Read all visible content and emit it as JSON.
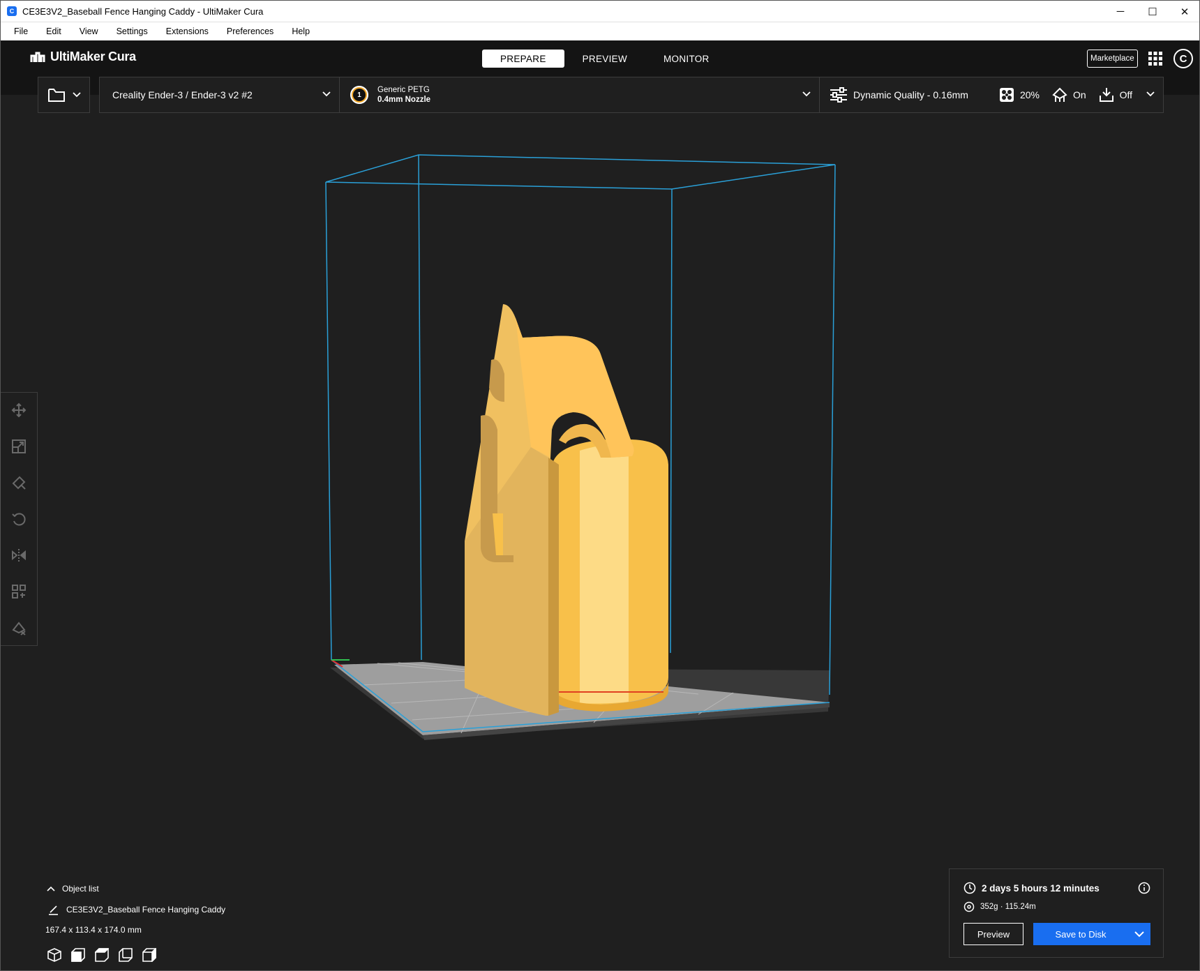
{
  "window": {
    "title": "CE3E3V2_Baseball Fence Hanging Caddy - UltiMaker Cura",
    "minimize": "─",
    "maximize": "☐",
    "close": "✕"
  },
  "menu": [
    "File",
    "Edit",
    "View",
    "Settings",
    "Extensions",
    "Preferences",
    "Help"
  ],
  "header": {
    "logo_text": "UltiMaker Cura",
    "stages": [
      "PREPARE",
      "PREVIEW",
      "MONITOR"
    ],
    "active_stage": "PREPARE",
    "marketplace_label": "Marketplace",
    "account_initial": "C"
  },
  "toolbar": {
    "printer": "Creality Ender-3 / Ender-3 v2 #2",
    "extruder_number": "1",
    "material": "Generic PETG",
    "nozzle": "0.4mm Nozzle",
    "profile": "Dynamic Quality - 0.16mm",
    "infill": "20%",
    "support": "On",
    "adhesion": "Off"
  },
  "left_tools": [
    "move-tool",
    "scale-tool",
    "support-blocker-tool",
    "rotate-tool",
    "mirror-tool",
    "per-model-settings-tool",
    "support-eraser-tool"
  ],
  "object_list": {
    "header": "Object list",
    "object_name": "CE3E3V2_Baseball Fence Hanging Caddy",
    "dimensions": "167.4 x 113.4 x 174.0 mm"
  },
  "action_panel": {
    "print_time": "2 days 5 hours 12 minutes",
    "material_usage": "352g · 115.24m",
    "preview_label": "Preview",
    "save_label": "Save to Disk"
  },
  "colors": {
    "accent": "#196ef0",
    "model": "#f8c04a",
    "build_volume": "#2aa0d8",
    "background": "#1f1f1f"
  }
}
